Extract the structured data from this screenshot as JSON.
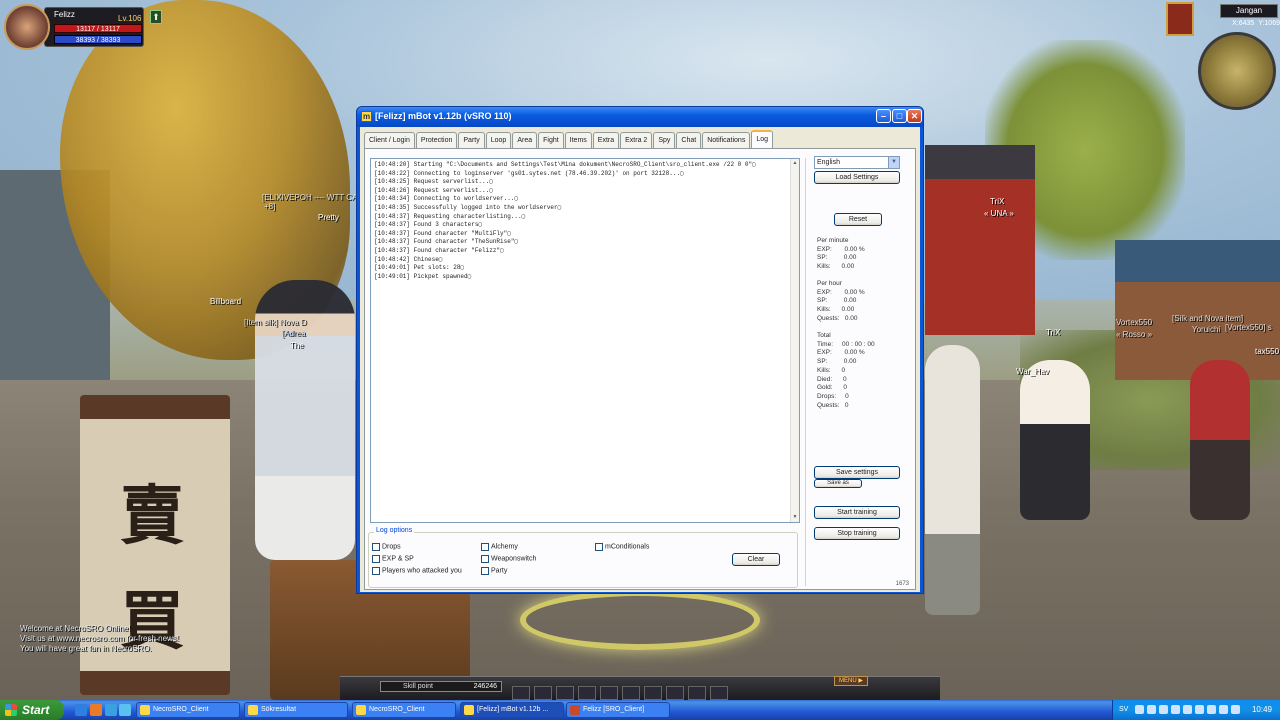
{
  "game": {
    "player": {
      "name": "Felizz",
      "level": "Lv.106",
      "hp": "13117 / 13117",
      "mp": "38393 / 38393"
    },
    "buff_icon": "⬆",
    "minimap": {
      "location": "Jangan",
      "x": "X:6435",
      "y": "Y:1069"
    },
    "names": {
      "elixir": "[ELIXIVEPOH ---- WTT CA",
      "elixir2": "+8]",
      "pretty": "Pretty",
      "billboard": "Billboard",
      "item_silk": "[Item silk] Nova D",
      "adrea": "[Adrea",
      "the": "The",
      "trix": "TriX",
      "una": "« UNA »",
      "vortex": "Vortex550",
      "rosso": "« Rosso »",
      "silk_item": "[Silk and Nova item]",
      "yoruichi": "Yoruichi",
      "vortex_s": "[Vortex550] s",
      "tax550": "tax550",
      "war_hav": "War_Hav",
      "trix2": "TriX"
    },
    "sign_chars": [
      "賣",
      "買"
    ],
    "chat": [
      "Welcome at NecroSRO Online!",
      "Visit us at www.necrosro.com for fresh news!",
      "You will have great fun in NecroSRO."
    ],
    "skill_point_label": "Skill point",
    "skill_point_value": "246246",
    "menu_label": "MENU ▶"
  },
  "window": {
    "title": "[Felizz] mBot v1.12b (vSRO 110)",
    "tabs": [
      "Client / Login",
      "Protection",
      "Party",
      "Loop",
      "Area",
      "Fight",
      "Items",
      "Extra",
      "Extra 2",
      "Spy",
      "Chat",
      "Notifications",
      "Log"
    ],
    "active_tab": "Log",
    "log": [
      "[10:48:20] Starting \"C:\\Documents and Settings\\Test\\Mina dokument\\NecroSRO_Client\\sro_client.exe /22 0 0\"▢",
      "[10:48:22] Connecting to loginserver 'gs01.sytes.net (78.46.39.202)' on port 32128...▢",
      "[10:48:25] Request serverlist...▢",
      "[10:48:26] Request serverlist...▢",
      "[10:48:34] Connecting to worldserver...▢",
      "[10:48:35] Successfully logged into the worldserver▢",
      "[10:48:37] Requesting characterlisting...▢",
      "[10:48:37] Found 3 characters▢",
      "[10:48:37] Found character \"MultiFly\"▢",
      "[10:48:37] Found character \"TheSunRise\"▢",
      "[10:48:37] Found character \"Felizz\"▢",
      "[10:48:42] Chinese▢",
      "[10:49:01] Pet slots: 28▢",
      "[10:49:01] Pickpet spawned▢"
    ],
    "log_options": {
      "legend": "Log options",
      "col1": [
        "Drops",
        "EXP & SP",
        "Players who attacked you"
      ],
      "col2": [
        "Alchemy",
        "Weaponswitch",
        "Party"
      ],
      "col3": [
        "mConditionals"
      ],
      "clear_label": "Clear"
    },
    "right": {
      "language": "English",
      "load_settings": "Load Settings",
      "reset": "Reset",
      "per_minute": "Per minute\nEXP:       0.00 %\nSP:         0.00\nKills:      0.00",
      "per_hour": "Per hour\nEXP:       0.00 %\nSP:         0.00\nKills:      0.00\nQuests:   0.00",
      "total": "Total\nTime:     00 : 00 : 00\nEXP:       0.00 %\nSP:         0.00\nKills:      0\nDied:      0\nGold:      0\nDrops:     0\nQuests:   0",
      "save_settings": "Save settings",
      "save_as": "Save as",
      "start_training": "Start training",
      "stop_training": "Stop training",
      "counter": "1673"
    }
  },
  "taskbar": {
    "start": "Start",
    "tasks": [
      {
        "label": "NecroSRO_Client",
        "active": false
      },
      {
        "label": "Sökresultat",
        "active": false
      },
      {
        "label": "NecroSRO_Client",
        "active": false
      },
      {
        "label": "[Felizz] mBot v1.12b ...",
        "active": true
      },
      {
        "label": "Felizz [SRO_Client]",
        "active": false
      }
    ],
    "tray_lang": "SV",
    "clock": "10:49"
  },
  "colors": {
    "xp_titlebar": "#0a5ce0",
    "xp_taskbar": "#2157d7",
    "start_green": "#3c9a3c"
  }
}
